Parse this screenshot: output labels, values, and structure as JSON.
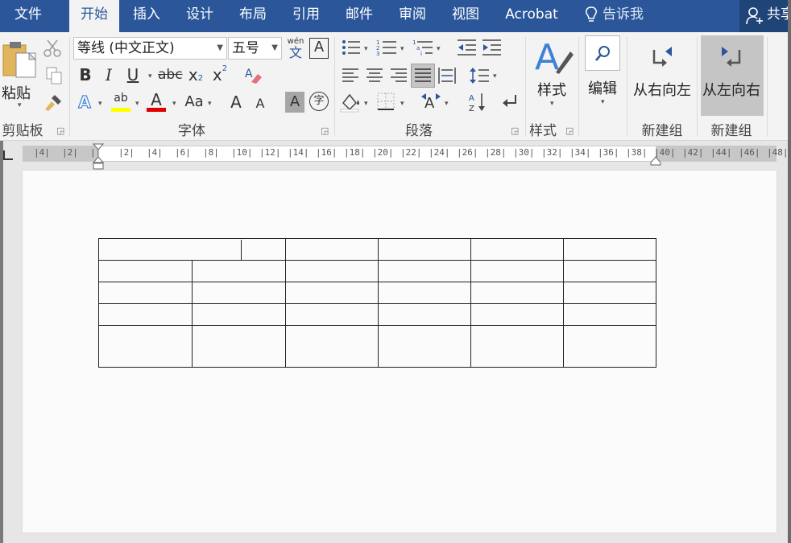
{
  "tabs": [
    {
      "label": "文件",
      "x": 34
    },
    {
      "label": "开始",
      "active": true
    },
    {
      "label": "插入"
    },
    {
      "label": "设计"
    },
    {
      "label": "布局"
    },
    {
      "label": "引用"
    },
    {
      "label": "邮件"
    },
    {
      "label": "审阅"
    },
    {
      "label": "视图"
    },
    {
      "label": "Acrobat"
    }
  ],
  "tell_me": "告诉我",
  "share_label": "共享",
  "clipboard": {
    "paste_label": "粘贴",
    "group_label": "剪贴板"
  },
  "font": {
    "font_name": "等线 (中文正文)",
    "font_size": "五号",
    "phonetic_top": "wén",
    "phonetic_bottom": "文",
    "char_border": "A",
    "bold": "B",
    "italic": "I",
    "underline": "U",
    "strike": "abc",
    "sub": "x",
    "sup": "x",
    "text_effect": "A",
    "highlight": "ab",
    "font_color": "A",
    "change_case": "Aa",
    "grow": "A",
    "shrink": "A",
    "char_shading": "A",
    "enclose": "字",
    "group_label": "字体",
    "highlight_color": "#ffff00",
    "font_color_value": "#e00000"
  },
  "paragraph": {
    "group_label": "段落"
  },
  "styles": {
    "button_label": "样式",
    "group_label": "样式"
  },
  "editing": {
    "button_label": "编辑"
  },
  "custom": {
    "rtl_label": "从右向左",
    "ltr_label": "从左向右",
    "group1_label": "新建组",
    "group2_label": "新建组"
  },
  "ruler": {
    "ticks": [
      "4",
      "2",
      "",
      "2",
      "4",
      "6",
      "8",
      "10",
      "12",
      "14",
      "16",
      "18",
      "20",
      "22",
      "24",
      "26",
      "28",
      "30",
      "32",
      "34",
      "36",
      "38",
      "40",
      "42",
      "44",
      "46",
      "48"
    ]
  },
  "document": {
    "table_rows": 5,
    "table_cols": 6
  }
}
